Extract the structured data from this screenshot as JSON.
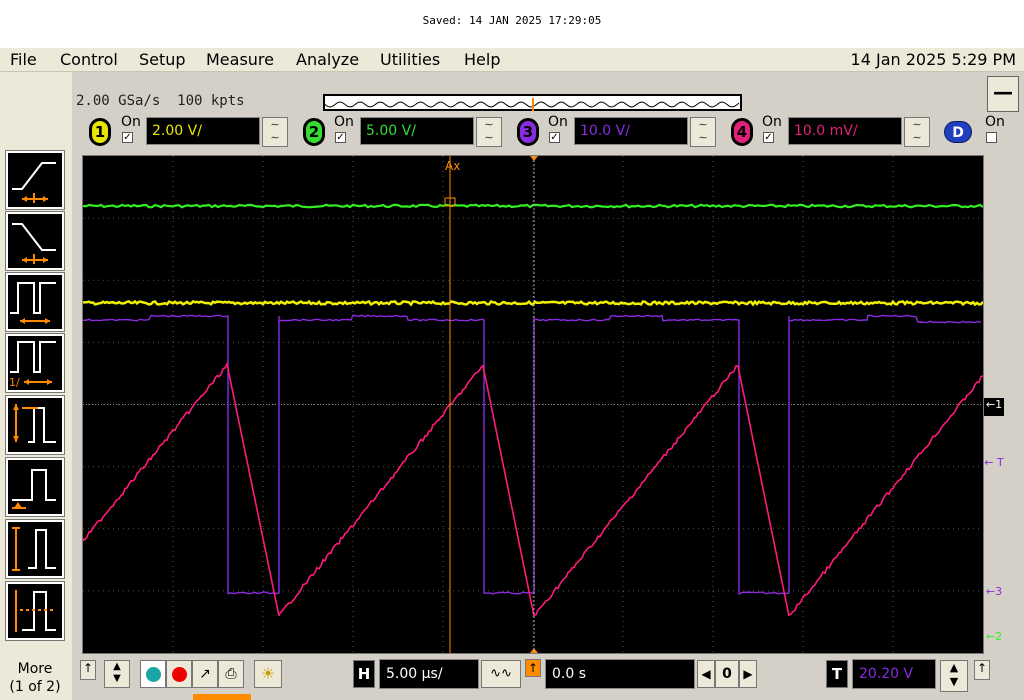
{
  "saved_banner": "Saved:  14 JAN 2025  17:29:05",
  "menu": {
    "items": [
      "File",
      "Control",
      "Setup",
      "Measure",
      "Analyze",
      "Utilities",
      "Help"
    ],
    "clock": "14 Jan 2025  5:29 PM"
  },
  "acquisition": {
    "rate": "2.00 GSa/s",
    "points": "100 kpts"
  },
  "minimize_label": "—",
  "channels": [
    {
      "num": "1",
      "on_label": "On",
      "checked": true,
      "scale": "2.00 V/",
      "color": "#e6e600"
    },
    {
      "num": "2",
      "on_label": "On",
      "checked": true,
      "scale": "5.00 V/",
      "color": "#33dd33"
    },
    {
      "num": "3",
      "on_label": "On",
      "checked": true,
      "scale": "10.0 V/",
      "color": "#8a2be2"
    },
    {
      "num": "4",
      "on_label": "On",
      "checked": true,
      "scale": "10.0 mV/",
      "color": "#e0207a"
    }
  ],
  "digital": {
    "label": "D",
    "on_label": "On",
    "checked": false
  },
  "marker": {
    "label": "Ax"
  },
  "right_markers": {
    "ch1": "1",
    "trigger": "T",
    "ch3": "3",
    "ch2": "2"
  },
  "left_panel": {
    "buttons": [
      "rising-edge",
      "falling-edge",
      "pulse-width",
      "pulse-width-ratio",
      "runt",
      "setup-hold",
      "transition",
      "timeout"
    ],
    "ratio_text": "1/",
    "more_label": "More",
    "more_page": "(1 of 2)"
  },
  "bottom": {
    "h_label": "H",
    "timebase": "5.00 µs/",
    "delay": "0.0 s",
    "page_num": "0",
    "t_label": "T",
    "trigger_level": "20.20 V"
  },
  "trace_colors": {
    "ch1": "#f0f000",
    "ch2": "#33ee22",
    "ch3": "#8a2be2",
    "ch4": "#ff1a7a",
    "grid": "#555555",
    "marker": "#ff8c00"
  }
}
